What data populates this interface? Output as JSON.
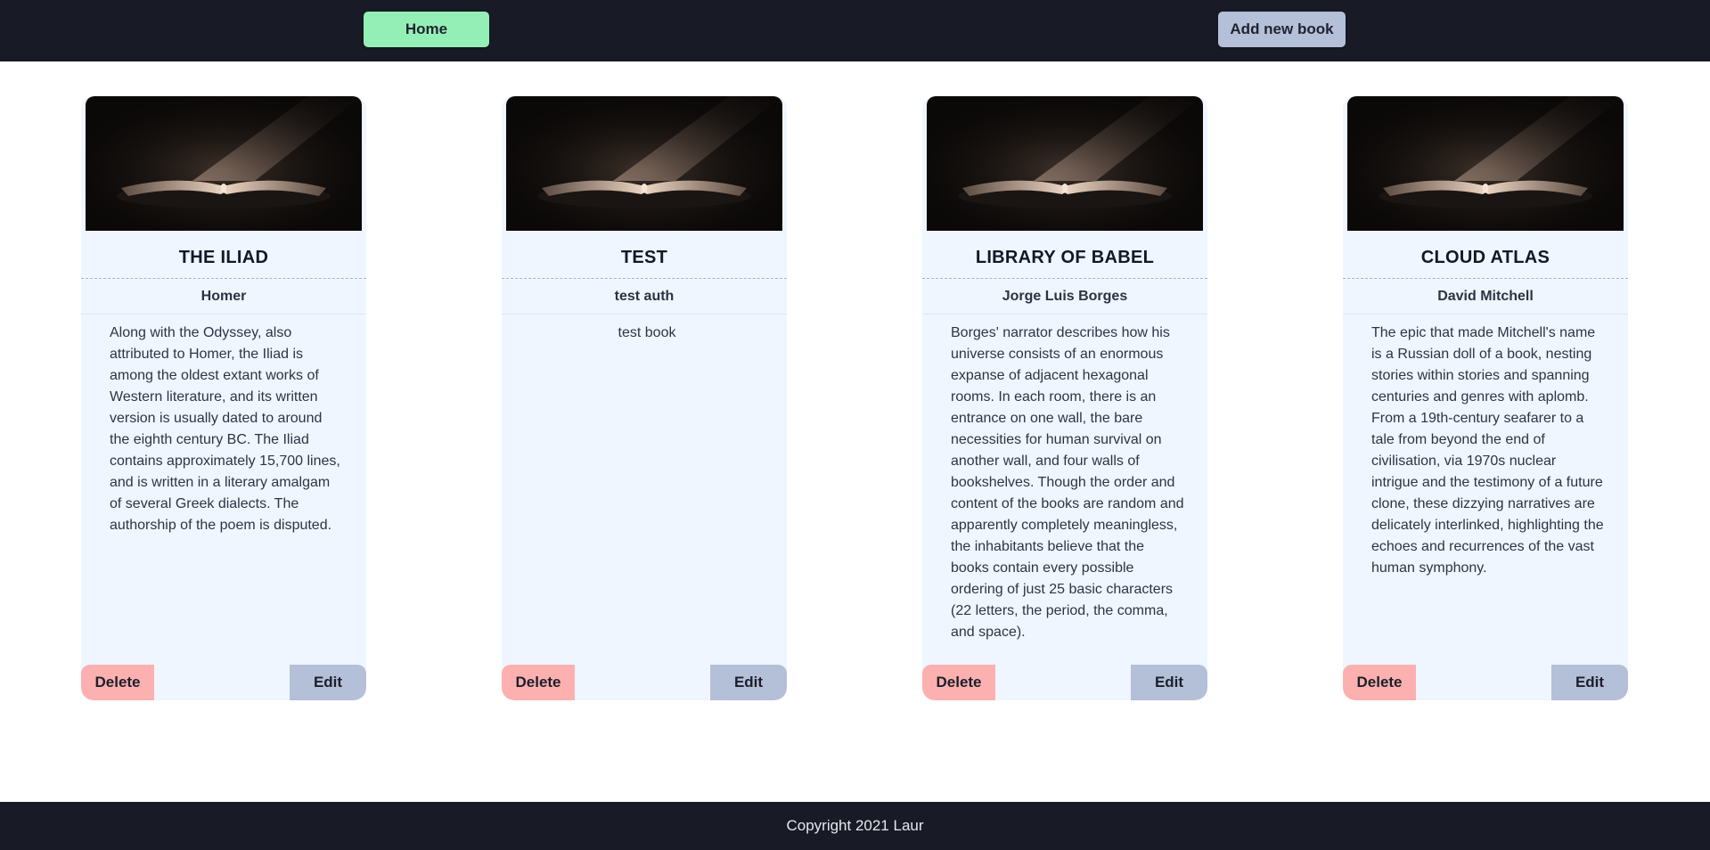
{
  "nav": {
    "home_label": "Home",
    "add_label": "Add new book"
  },
  "books": [
    {
      "title": "THE ILIAD",
      "author": "Homer",
      "description": "Along with the Odyssey, also attributed to Homer, the Iliad is among the oldest extant works of Western literature, and its written version is usually dated to around the eighth century BC. The Iliad contains approximately 15,700 lines, and is written in a literary amalgam of several Greek dialects. The authorship of the poem is disputed.",
      "delete_label": "Delete",
      "edit_label": "Edit"
    },
    {
      "title": "TEST",
      "author": "test auth",
      "description": "test book",
      "delete_label": "Delete",
      "edit_label": "Edit"
    },
    {
      "title": "LIBRARY OF BABEL",
      "author": "Jorge Luis Borges",
      "description": "Borges' narrator describes how his universe consists of an enormous expanse of adjacent hexagonal rooms. In each room, there is an entrance on one wall, the bare necessities for human survival on another wall, and four walls of bookshelves. Though the order and content of the books are random and apparently completely meaningless, the inhabitants believe that the books contain every possible ordering of just 25 basic characters (22 letters, the period, the comma, and space).",
      "delete_label": "Delete",
      "edit_label": "Edit"
    },
    {
      "title": "CLOUD ATLAS",
      "author": "David Mitchell",
      "description": "The epic that made Mitchell's name is a Russian doll of a book, nesting stories within stories and spanning centuries and genres with aplomb. From a 19th-century seafarer to a tale from beyond the end of civilisation, via 1970s nuclear intrigue and the testimony of a future clone, these dizzying narratives are delicately interlinked, highlighting the echoes and recurrences of the vast human symphony.",
      "delete_label": "Delete",
      "edit_label": "Edit"
    }
  ],
  "footer": {
    "copyright": "Copyright 2021 Laur"
  },
  "colors": {
    "navbar": "#181b25",
    "home_button": "#94efb7",
    "secondary_button": "#b4bfd8",
    "delete_button": "#fdb0b0",
    "card_background": "#eff6ff"
  },
  "icons": {
    "book_cover": "open-book-image"
  }
}
